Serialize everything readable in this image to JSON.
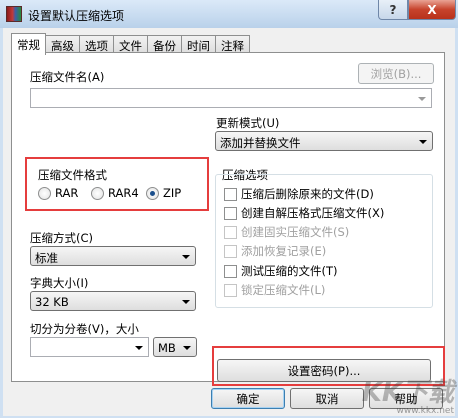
{
  "window": {
    "title": "设置默认压缩选项",
    "help_glyph": "?",
    "close_glyph": "X"
  },
  "tabs": [
    {
      "label": "常规",
      "active": true
    },
    {
      "label": "高级"
    },
    {
      "label": "选项"
    },
    {
      "label": "文件"
    },
    {
      "label": "备份"
    },
    {
      "label": "时间"
    },
    {
      "label": "注释"
    }
  ],
  "archive_name": {
    "label": "压缩文件名(A)",
    "value": "",
    "browse_label": "浏览(B)..."
  },
  "update_mode": {
    "label": "更新模式(U)",
    "value": "添加并替换文件"
  },
  "archive_format": {
    "title": "压缩文件格式",
    "options": [
      {
        "label": "RAR",
        "selected": false
      },
      {
        "label": "RAR4",
        "selected": false
      },
      {
        "label": "ZIP",
        "selected": true
      }
    ]
  },
  "compression_method": {
    "label": "压缩方式(C)",
    "value": "标准"
  },
  "dictionary_size": {
    "label": "字典大小(I)",
    "value": "32 KB"
  },
  "split_volumes": {
    "label": "切分为分卷(V)，大小",
    "value": "",
    "unit": "MB"
  },
  "archive_options": {
    "title": "压缩选项",
    "items": [
      {
        "label": "压缩后删除原来的文件(D)",
        "checked": false,
        "disabled": false
      },
      {
        "label": "创建自解压格式压缩文件(X)",
        "checked": false,
        "disabled": false
      },
      {
        "label": "创建固实压缩文件(S)",
        "checked": false,
        "disabled": true
      },
      {
        "label": "添加恢复记录(E)",
        "checked": false,
        "disabled": true
      },
      {
        "label": "测试压缩的文件(T)",
        "checked": false,
        "disabled": false
      },
      {
        "label": "锁定压缩文件(L)",
        "checked": false,
        "disabled": true
      }
    ]
  },
  "set_password_label": "设置密码(P)...",
  "footer": {
    "ok_label": "确定",
    "cancel_label": "取消",
    "help_label": "帮助"
  },
  "watermark": {
    "logo_text": "KK下载",
    "url": "www.kkx.net"
  },
  "colors": {
    "highlight": "#e53d3d",
    "dialog_bg": "#f0f0f0",
    "titlebar": "#c7dbf0"
  }
}
